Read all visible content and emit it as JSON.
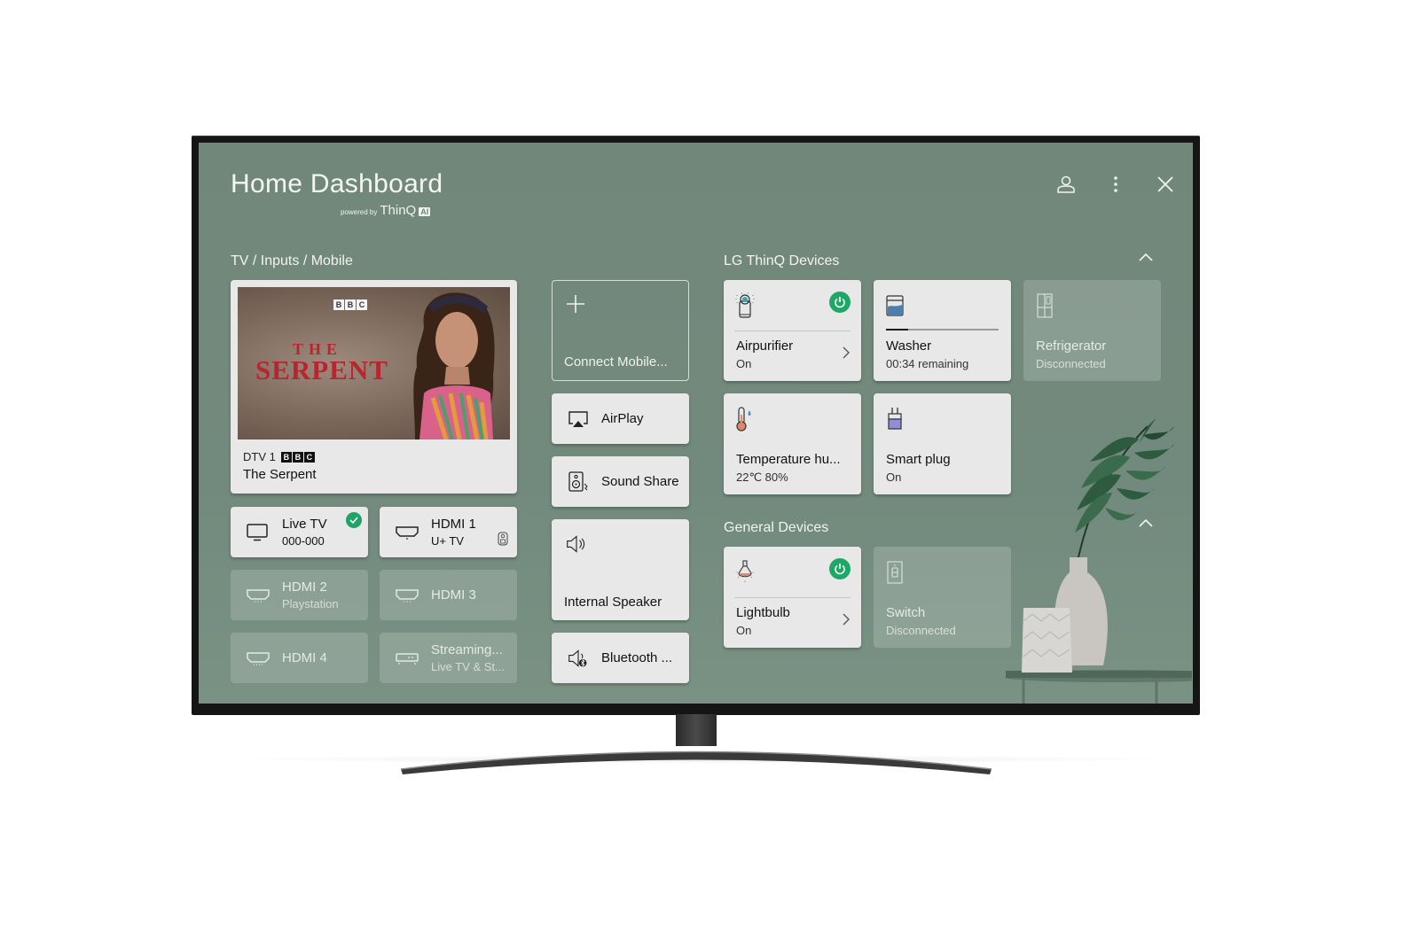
{
  "header": {
    "title": "Home Dashboard",
    "powered_by": "powered by",
    "brand": "ThinQ",
    "brand_badge": "AI",
    "icons": [
      "profile-icon",
      "more-options-icon",
      "close-icon"
    ]
  },
  "tv_inputs_section": {
    "label": "TV / Inputs / Mobile",
    "now_playing": {
      "thumb_network": "BBC",
      "thumb_title_small": "THE",
      "thumb_title_large": "SERPENT",
      "channel": "DTV 1",
      "network": "BBC",
      "program": "The Serpent"
    },
    "inputs": [
      {
        "name": "Live TV",
        "sub": "000-000",
        "icon": "tv-icon",
        "active": true,
        "selected": true
      },
      {
        "name": "HDMI 1",
        "sub": "U+ TV",
        "icon": "hdmi-icon",
        "active": true,
        "remote": true
      },
      {
        "name": "HDMI 2",
        "sub": "Playstation",
        "icon": "hdmi-icon",
        "active": false
      },
      {
        "name": "HDMI 3",
        "sub": "",
        "icon": "hdmi-icon",
        "active": false
      },
      {
        "name": "HDMI 4",
        "sub": "",
        "icon": "hdmi-icon",
        "active": false
      },
      {
        "name": "Streaming...",
        "sub": "Live TV & St...",
        "icon": "set-top-box-icon",
        "active": false
      }
    ],
    "mobile_audio": [
      {
        "label": "Connect Mobile...",
        "icon": "plus-icon"
      },
      {
        "label": "AirPlay",
        "icon": "airplay-icon"
      },
      {
        "label": "Sound Share",
        "icon": "sound-share-icon"
      },
      {
        "label": "Internal Speaker",
        "icon": "speaker-icon"
      },
      {
        "label": "Bluetooth ...",
        "icon": "bluetooth-speaker-icon"
      }
    ]
  },
  "thinq_section": {
    "label": "LG ThinQ Devices",
    "devices": [
      {
        "name": "Airpurifier",
        "status": "On",
        "icon": "air-purifier-icon",
        "power": true,
        "connected": true
      },
      {
        "name": "Washer",
        "status": "00:34 remaining",
        "icon": "washer-icon",
        "progress": 0.2,
        "connected": true
      },
      {
        "name": "Refrigerator",
        "status": "Disconnected",
        "icon": "refrigerator-icon",
        "connected": false
      },
      {
        "name": "Temperature hu...",
        "status": "22℃ 80%",
        "icon": "thermo-hygrometer-icon",
        "connected": true
      },
      {
        "name": "Smart plug",
        "status": "On",
        "icon": "smart-plug-icon",
        "connected": true
      }
    ]
  },
  "general_section": {
    "label": "General Devices",
    "devices": [
      {
        "name": "Lightbulb",
        "status": "On",
        "icon": "lightbulb-icon",
        "power": true,
        "connected": true
      },
      {
        "name": "Switch",
        "status": "Disconnected",
        "icon": "switch-icon",
        "connected": false
      }
    ]
  },
  "colors": {
    "background": "#71877a",
    "card": "#e8e8e8",
    "power_on": "#1ea866",
    "check": "#21a366"
  }
}
